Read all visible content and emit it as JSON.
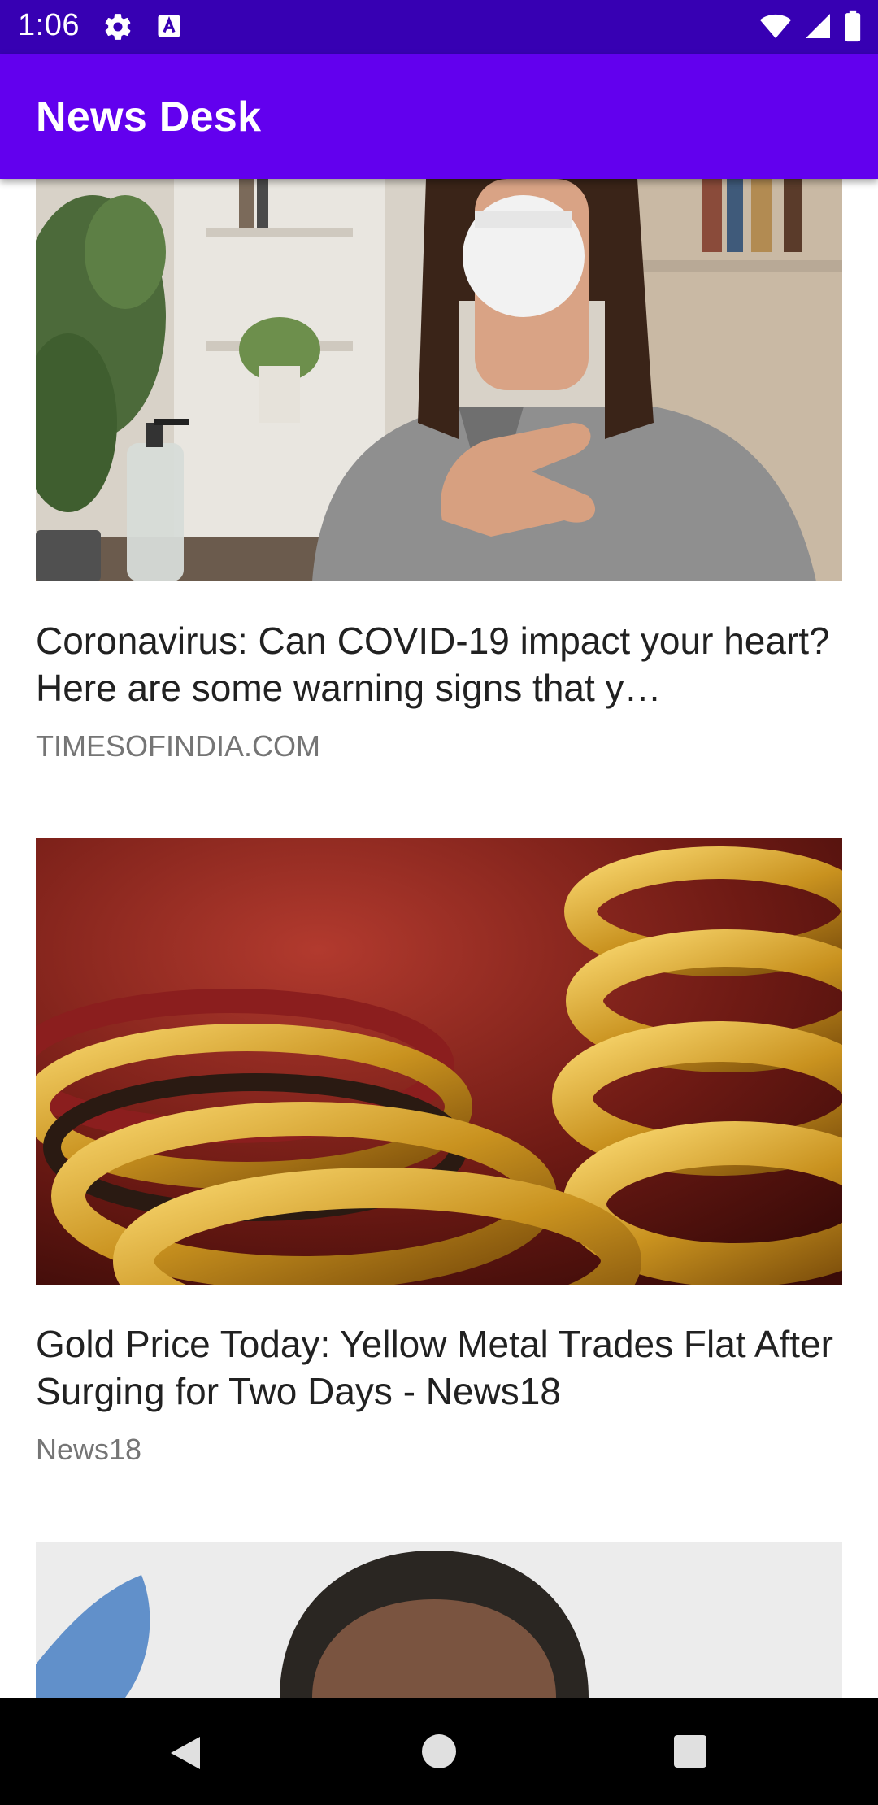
{
  "status_bar": {
    "time": "1:06",
    "icons": [
      "settings-gear-icon",
      "text-a-icon",
      "wifi-icon",
      "signal-icon",
      "battery-icon"
    ]
  },
  "app_bar": {
    "title": "News Desk",
    "color": "#6200ee",
    "status_color": "#3700b3"
  },
  "articles": [
    {
      "title": "Coronavirus: Can COVID-19 impact your heart? Here are some warning signs that y…",
      "source": "TIMESOFINDIA.COM",
      "image": "woman-mask-photo"
    },
    {
      "title": "Gold Price Today: Yellow Metal Trades Flat After Surging for Two Days - News18",
      "source": "News18",
      "image": "gold-bangles-photo"
    },
    {
      "title": "",
      "source": "",
      "image": "man-portrait-photo"
    }
  ],
  "nav_bar": {
    "icons": [
      "back-icon",
      "home-icon",
      "recents-icon"
    ]
  }
}
